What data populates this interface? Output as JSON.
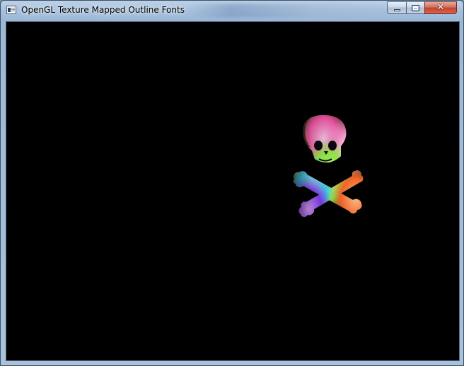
{
  "window": {
    "title": "OpenGL Texture Mapped Outline Fonts"
  },
  "caption": {
    "minimize_icon": "minimize-icon",
    "maximize_icon": "maximize-icon",
    "close_glyph": "✕"
  },
  "scene": {
    "background": "#000000",
    "symbol": "skull-and-crossbones",
    "palette": [
      "#ff5db0",
      "#ffd37a",
      "#9cff4a",
      "#3ee0ff",
      "#8a3cff",
      "#ff6a2a",
      "#7aff6a"
    ]
  }
}
